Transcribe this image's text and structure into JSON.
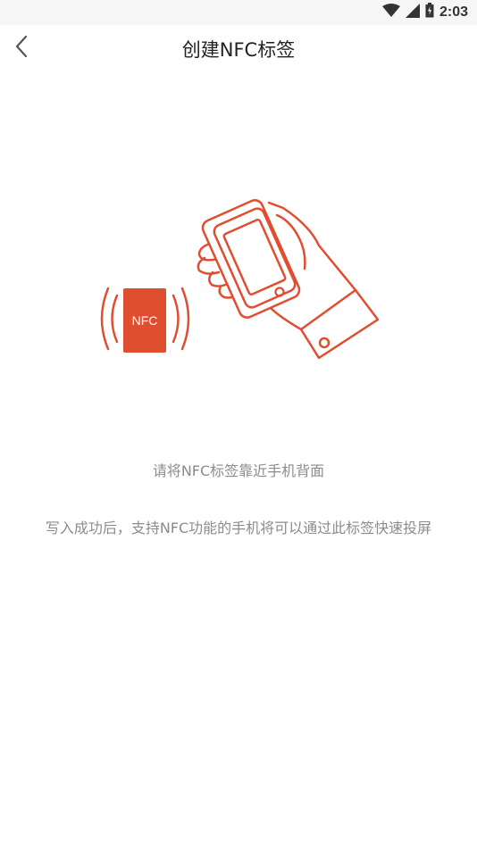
{
  "status_bar": {
    "time": "2:03",
    "icons": [
      "wifi-icon",
      "signal-icon",
      "battery-icon"
    ]
  },
  "header": {
    "title": "创建NFC标签",
    "back_icon": "chevron-left-icon"
  },
  "illustration": {
    "tag_label": "NFC",
    "accent_color": "#E04E30"
  },
  "main": {
    "hint": "请将NFC标签靠近手机背面",
    "description": "写入成功后，支持NFC功能的手机将可以通过此标签快速投屏"
  }
}
